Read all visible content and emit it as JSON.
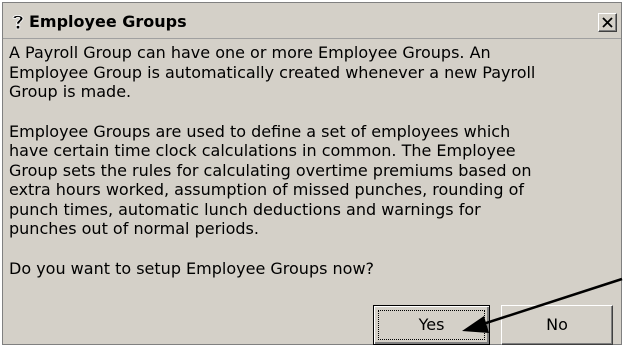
{
  "window": {
    "title": "Employee Groups",
    "title_icon": "question-mark-icon",
    "close_icon": "close-icon"
  },
  "message": {
    "paragraph_1": "A Payroll Group can have one or more Employee Groups. An\nEmployee Group is automatically created whenever a new Payroll\nGroup is made.",
    "paragraph_2": "Employee Groups are used to define a set of employees which\nhave certain time clock calculations in common. The Employee\nGroup sets the rules for calculating overtime premiums based on\nextra hours worked, assumption of missed punches, rounding of\npunch times, automatic lunch deductions and warnings for\npunches out of normal periods.",
    "question": "Do you want to setup Employee Groups now?"
  },
  "buttons": {
    "yes_label": "Yes",
    "no_label": "No"
  },
  "annotation": {
    "type": "arrow",
    "target": "yes-button",
    "color": "#000000"
  },
  "colors": {
    "dialog_background": "#d4d0c8",
    "text": "#000000"
  }
}
